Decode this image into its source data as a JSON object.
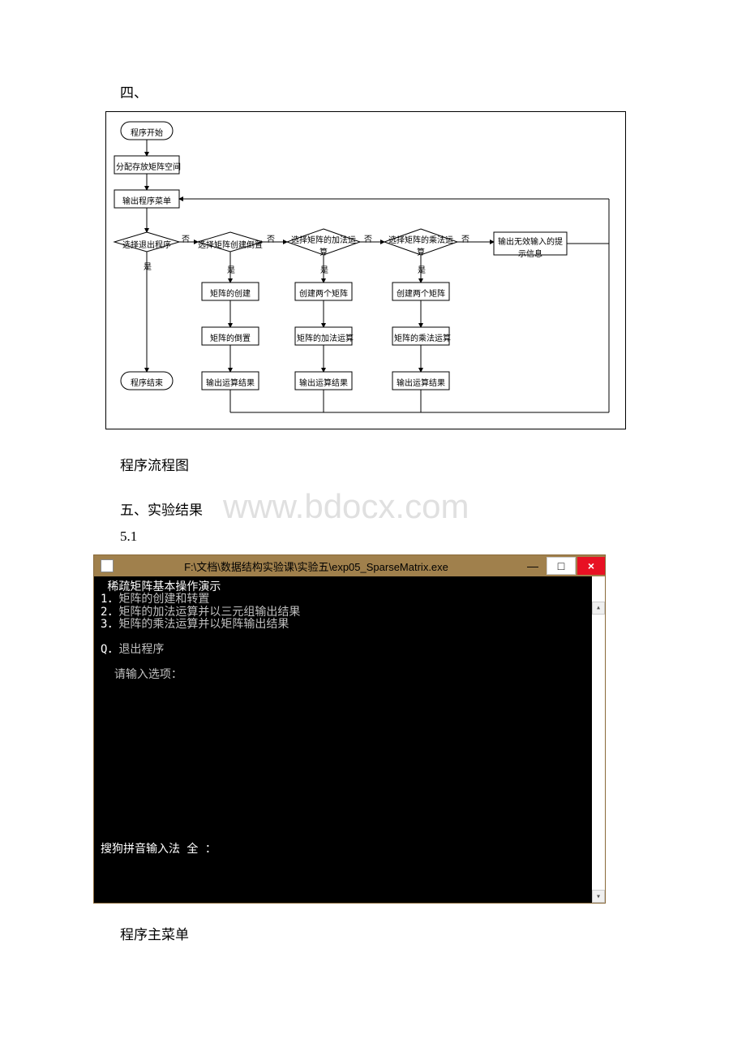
{
  "section4_label": "四、",
  "flowchart_caption": "程序流程图",
  "section5_label": "五、实验结果",
  "subsection_label": "5.1",
  "watermark": "www.bdocx.com",
  "flowchart": {
    "start": "程序开始",
    "alloc": "分配存放矩阵空间",
    "menu": "输出程序菜单",
    "select_exit": "选择退出程序",
    "select_create": "选择矩阵创建倒置",
    "select_add": "选择矩阵的加法运\n算",
    "select_mul": "选择矩阵的乘法运\n算",
    "invalid": "输出无效输入的提\n示信息",
    "no": "否",
    "yes": "是",
    "create": "矩阵的创建",
    "transpose": "矩阵的倒置",
    "add_create": "创建两个矩阵",
    "add_op": "矩阵的加法运算",
    "mul_create": "创建两个矩阵",
    "mul_op": "矩阵的乘法运算",
    "out1": "输出运算结果",
    "out2": "输出运算结果",
    "out3": "输出运算结果",
    "end": "程序结束"
  },
  "console": {
    "title": "F:\\文档\\数据结构实验课\\实验五\\exp05_SparseMatrix.exe",
    "line_header": " 稀疏矩阵基本操作演示",
    "line1_num": "1．",
    "line1_txt": "矩阵的创建和转置",
    "line2_num": "2．",
    "line2_txt": "矩阵的加法运算并以三元组输出结果",
    "line3_num": "3．",
    "line3_txt": "矩阵的乘法运算并以矩阵输出结果",
    "lineQ_num": "Q．",
    "lineQ_txt": "退出程序",
    "prompt": "  请输入选项：",
    "ime": "搜狗拼音输入法 全 ："
  },
  "console_caption": "程序主菜单"
}
